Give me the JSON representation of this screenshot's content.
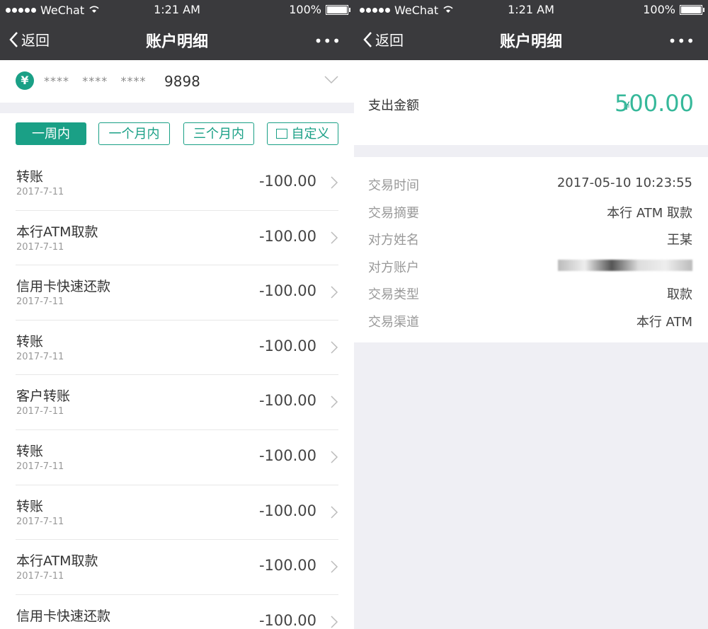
{
  "status": {
    "carrier": "WeChat",
    "time": "1:21 AM",
    "battery": "100%"
  },
  "nav": {
    "back": "返回",
    "title": "账户明细",
    "more": "•••"
  },
  "card": {
    "mask1": "****",
    "mask2": "****",
    "mask3": "****",
    "last4": "9898"
  },
  "filters": [
    "一周内",
    "一个月内",
    "三个月内",
    "自定义"
  ],
  "transactions": [
    {
      "name": "转账",
      "date": "2017-7-11",
      "amount": "-100.00"
    },
    {
      "name": "本行ATM取款",
      "date": "2017-7-11",
      "amount": "-100.00"
    },
    {
      "name": "信用卡快速还款",
      "date": "2017-7-11",
      "amount": "-100.00"
    },
    {
      "name": "转账",
      "date": "2017-7-11",
      "amount": "-100.00"
    },
    {
      "name": "客户转账",
      "date": "2017-7-11",
      "amount": "-100.00"
    },
    {
      "name": "转账",
      "date": "2017-7-11",
      "amount": "-100.00"
    },
    {
      "name": "转账",
      "date": "2017-7-11",
      "amount": "-100.00"
    },
    {
      "name": "本行ATM取款",
      "date": "2017-7-11",
      "amount": "-100.00"
    },
    {
      "name": "信用卡快速还款",
      "date": "",
      "amount": "-100.00"
    }
  ],
  "detail": {
    "amount_label": "支出金额",
    "currency": "¥",
    "amount": "500.00",
    "rows": [
      {
        "key": "交易时间",
        "value": "2017-05-10 10:23:55"
      },
      {
        "key": "交易摘要",
        "value": "本行 ATM 取款"
      },
      {
        "key": "对方姓名",
        "value": "王某"
      },
      {
        "key": "对方账户",
        "value": ""
      },
      {
        "key": "交易类型",
        "value": "取款"
      },
      {
        "key": "交易渠道",
        "value": "本行 ATM"
      }
    ]
  },
  "colors": {
    "accent": "#1aa086",
    "navbar": "#3a3a3d",
    "background": "#efeff4"
  }
}
